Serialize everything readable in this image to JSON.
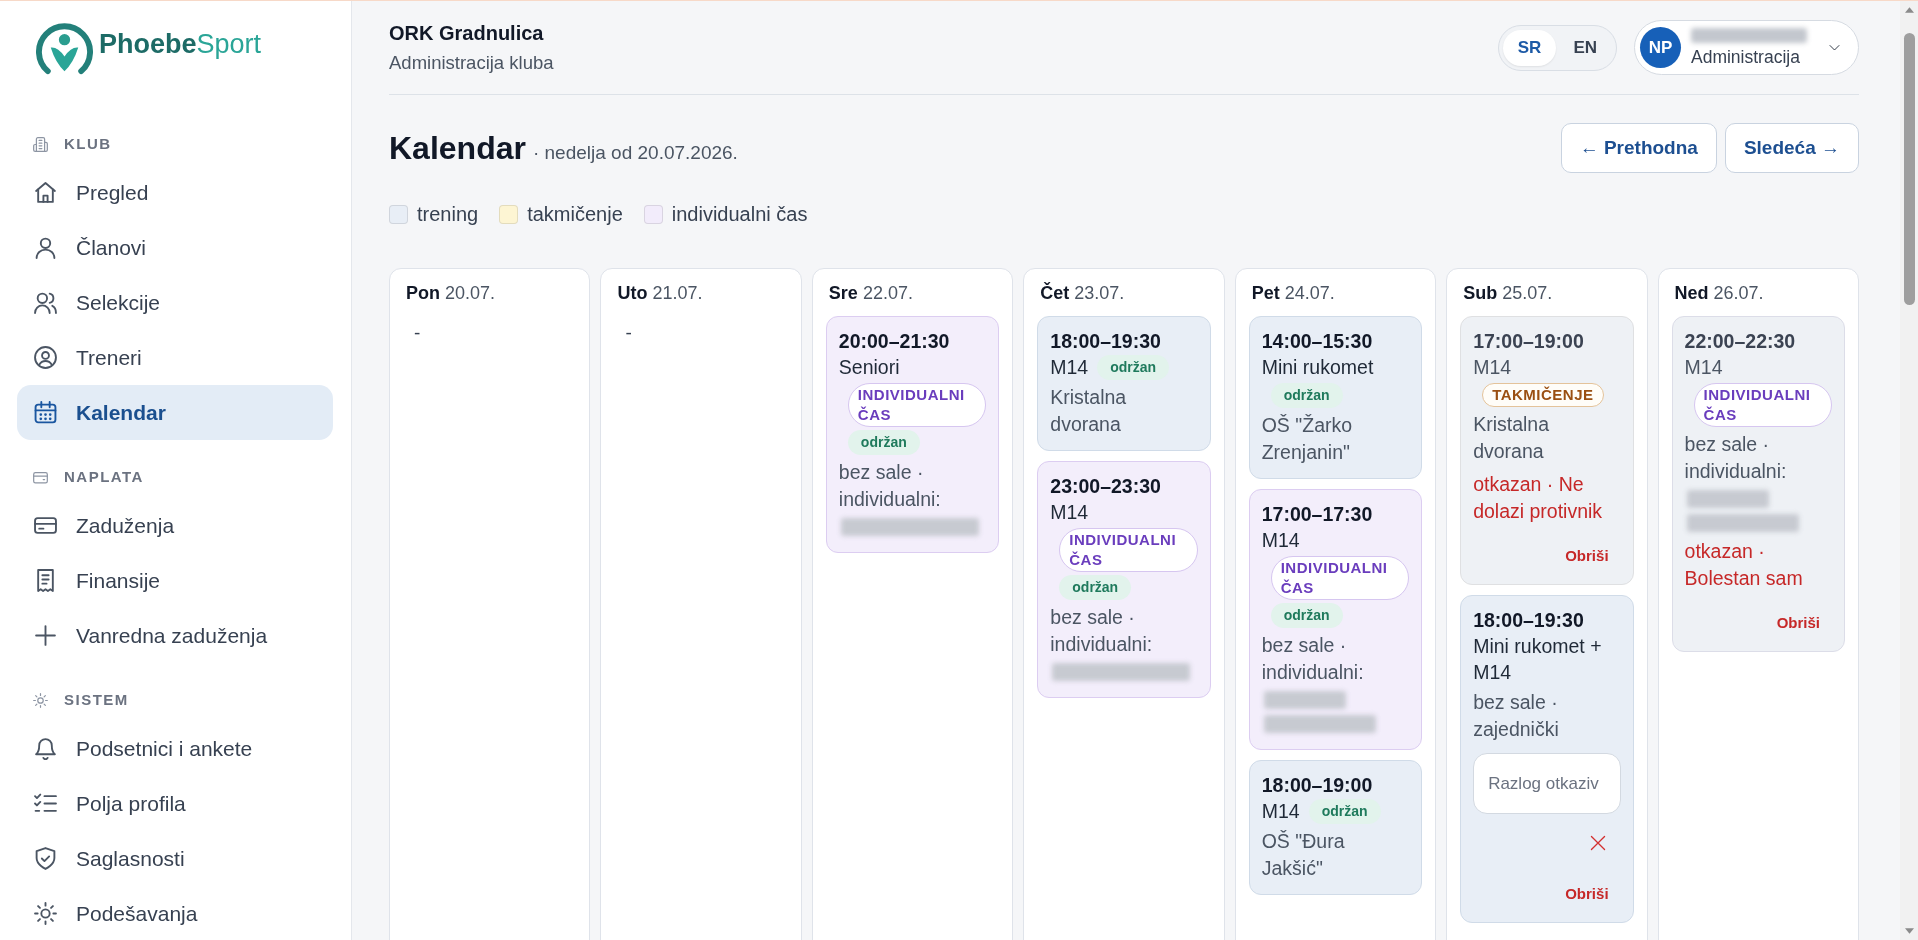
{
  "sidebar": {
    "brand": "**Phoebe**Sport",
    "sections": [
      {
        "title": "KLUB",
        "items": [
          {
            "label": "Pregled",
            "selected": false
          },
          {
            "label": "Članovi",
            "selected": false
          },
          {
            "label": "Selekcije",
            "selected": false
          },
          {
            "label": "Treneri",
            "selected": false
          },
          {
            "label": "Kalendar",
            "selected": true
          }
        ]
      },
      {
        "title": "NAPLATA",
        "items": [
          {
            "label": "Zaduženja",
            "selected": false
          },
          {
            "label": "Finansije",
            "selected": false
          },
          {
            "label": "Vanredna zaduženja",
            "selected": false
          }
        ]
      },
      {
        "title": "SISTEM",
        "items": [
          {
            "label": "Podsetnici i ankete",
            "selected": false
          },
          {
            "label": "Polja profila",
            "selected": false
          },
          {
            "label": "Saglasnosti",
            "selected": false
          },
          {
            "label": "Podešavanja",
            "selected": false
          }
        ]
      }
    ]
  },
  "header": {
    "club": "ORK Gradnulica",
    "subtitle": "Administracija kluba",
    "languages": [
      {
        "label": "SR",
        "selected": true
      },
      {
        "label": "EN",
        "selected": false
      }
    ],
    "user": {
      "initials": "NP",
      "name_hidden": true,
      "role": "Administracija"
    }
  },
  "calendar": {
    "title": "Kalendar",
    "week_label": "· nedelja od 20.07.2026.",
    "prev_button": "← Prethodna",
    "next_button": "Sledeća →",
    "legend": [
      {
        "label": "trening",
        "color": "#e8eef6"
      },
      {
        "label": "takmičenje",
        "color": "#fdf5d3"
      },
      {
        "label": "individualni čas",
        "color": "#f2ecfb"
      }
    ],
    "days": [
      {
        "day": "Pon",
        "date": "20.07.",
        "empty_text": "-"
      },
      {
        "day": "Uto",
        "date": "21.07.",
        "empty_text": "-"
      },
      {
        "day": "Sre",
        "date": "22.07.",
        "events": [
          {
            "time": "20:00–21:30",
            "title": "Seniori",
            "kind": "individual",
            "cancelled": false,
            "badges": [
              {
                "kind": "individual",
                "label": "INDIVIDUALNI ČAS"
              },
              {
                "kind": "held",
                "label": "održan"
              }
            ],
            "location": "bez sale · individualni:",
            "name_lines": [
              {
                "kind": "blurred"
              }
            ]
          }
        ]
      },
      {
        "day": "Čet",
        "date": "23.07.",
        "events": [
          {
            "time": "18:00–19:30",
            "title": "M14",
            "kind": "training",
            "cancelled": false,
            "badges": [
              {
                "kind": "held",
                "label": "održan"
              }
            ],
            "location": "Kristalna dvorana"
          },
          {
            "time": "23:00–23:30",
            "title": "M14",
            "kind": "individual",
            "cancelled": false,
            "badges": [
              {
                "kind": "individual",
                "label": "INDIVIDUALNI ČAS"
              },
              {
                "kind": "held",
                "label": "održan"
              }
            ],
            "location": "bez sale · individualni:",
            "name_lines": [
              {
                "kind": "blurred"
              }
            ]
          }
        ]
      },
      {
        "day": "Pet",
        "date": "24.07.",
        "events": [
          {
            "time": "14:00–15:30",
            "title": "Mini rukomet",
            "kind": "training",
            "cancelled": false,
            "badges": [
              {
                "kind": "held",
                "label": "održan"
              }
            ],
            "location": "OŠ \"Žarko Zrenjanin\""
          },
          {
            "time": "17:00–17:30",
            "title": "M14",
            "kind": "individual",
            "cancelled": false,
            "badges": [
              {
                "kind": "individual",
                "label": "INDIVIDUALNI ČAS"
              },
              {
                "kind": "held",
                "label": "održan"
              }
            ],
            "location": "bez sale · individualni:",
            "name_lines": [
              {
                "kind": "blurred"
              },
              {
                "kind": "blurred"
              }
            ]
          },
          {
            "time": "18:00–19:00",
            "title": "M14",
            "kind": "training",
            "cancelled": false,
            "badges": [
              {
                "kind": "held",
                "label": "održan"
              }
            ],
            "location": "OŠ \"Đura Jakšić\""
          }
        ]
      },
      {
        "day": "Sub",
        "date": "25.07.",
        "events": [
          {
            "time": "17:00–19:00",
            "title": "M14",
            "kind": "competition",
            "cancelled": true,
            "badges": [
              {
                "kind": "competition",
                "label": "TAKMIČENJE"
              }
            ],
            "location": "Kristalna dvorana",
            "cancel_note": "otkazan · Ne dolazi protivnik",
            "delete_label": "Obriši"
          },
          {
            "time": "18:00–19:30",
            "title": "Mini rukomet + M14",
            "kind": "training",
            "cancelled": false,
            "location": "bez sale · zajednički",
            "cancel_form": {
              "placeholder": "Razlog otkaziv"
            },
            "delete_label": "Obriši"
          }
        ]
      },
      {
        "day": "Ned",
        "date": "26.07.",
        "events": [
          {
            "time": "22:00–22:30",
            "title": "M14",
            "kind": "individual",
            "cancelled": true,
            "badges": [
              {
                "kind": "individual",
                "label": "INDIVIDUALNI ČAS"
              }
            ],
            "location": "bez sale · individualni:",
            "name_lines": [
              {
                "kind": "blurred"
              },
              {
                "kind": "blurred"
              }
            ],
            "cancel_note": "otkazan · Bolestan sam",
            "delete_label": "Obriši"
          }
        ]
      }
    ]
  }
}
